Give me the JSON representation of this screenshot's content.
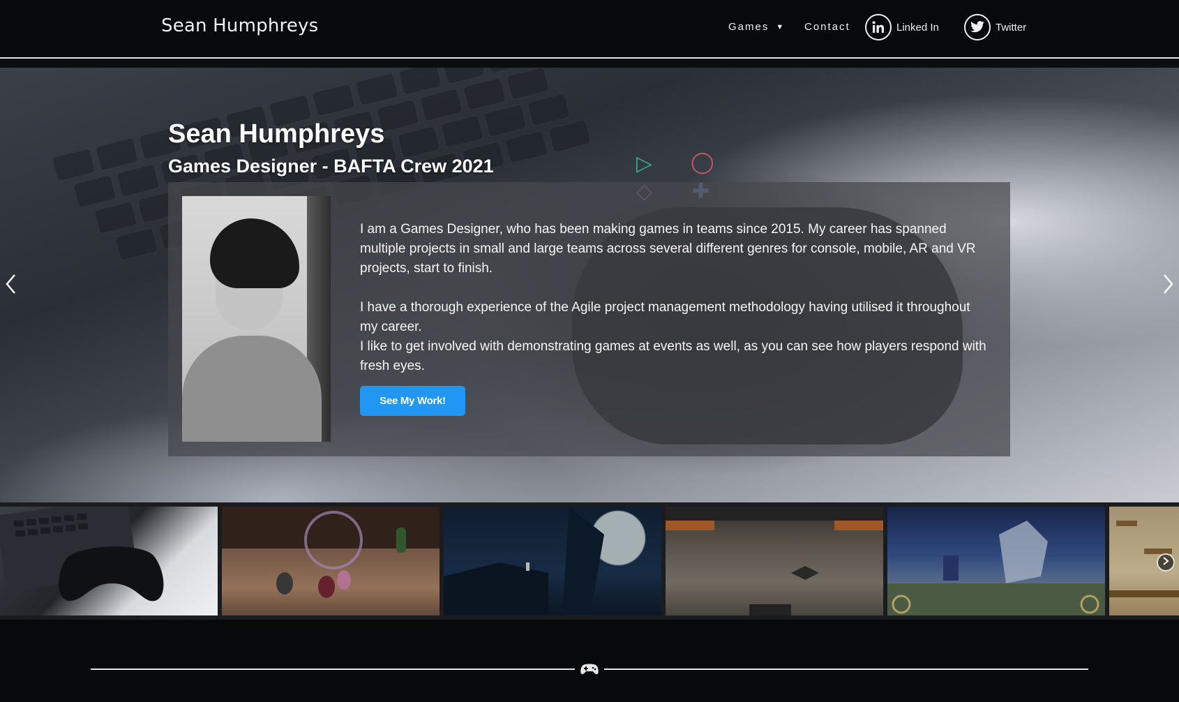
{
  "header": {
    "site_title": "Sean Humphreys",
    "nav": {
      "games_label": "Games",
      "contact_label": "Contact",
      "linkedin_label": "Linked In",
      "twitter_label": "Twitter"
    }
  },
  "hero": {
    "title": "Sean Humphreys",
    "subtitle": "Games Designer - BAFTA Crew 2021",
    "paragraphs": {
      "p1": "I am a Games Designer, who has been making games in teams since 2015. My career has spanned multiple projects in small and large teams across several different genres for console, mobile, AR and VR projects, start to finish.",
      "p2": "I have a thorough experience of the Agile project management methodology having utilised it throughout my career.",
      "p3": "I like to get involved with demonstrating games at events as well, as you can see how players respond with fresh eyes."
    },
    "cta_label": "See My Work!",
    "cta_color": "#2196f3"
  },
  "icons": {
    "linkedin": "linkedin-icon",
    "twitter": "twitter-icon",
    "chevron": "chevron-down-icon",
    "prev": "chevron-left-icon",
    "next": "chevron-right-icon",
    "divider": "gamepad-icon"
  },
  "thumbnails": {
    "count_visible": 6
  },
  "colors": {
    "background": "#07090b",
    "accent": "#2196f3"
  }
}
